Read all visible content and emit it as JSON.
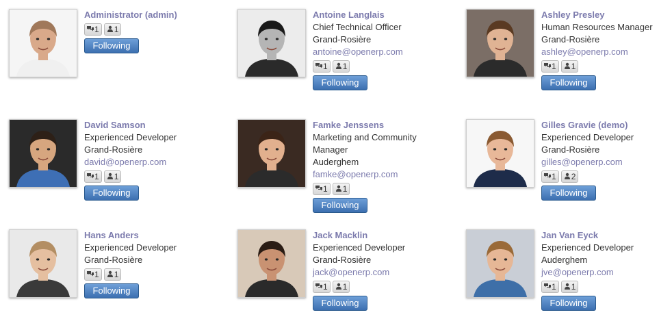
{
  "users": [
    {
      "name": "Administrator (admin)",
      "lines": [],
      "email": "",
      "messages": "1",
      "followers": "1",
      "button": "Following",
      "colors": {
        "bg": "#f5f5f5",
        "skin": "#d9a98a",
        "hair": "#a0785a",
        "shirt": "#f0f0f0"
      }
    },
    {
      "name": "Antoine Langlais",
      "lines": [
        "Chief Technical Officer",
        "Grand-Rosière"
      ],
      "email": "antoine@openerp.com",
      "messages": "1",
      "followers": "1",
      "button": "Following",
      "colors": {
        "bg": "#ececec",
        "skin": "#b5b5b5",
        "hair": "#1a1a1a",
        "shirt": "#2a2a2a"
      }
    },
    {
      "name": "Ashley Presley",
      "lines": [
        "Human Resources Manager",
        "Grand-Rosière"
      ],
      "email": "ashley@openerp.com",
      "messages": "1",
      "followers": "1",
      "button": "Following",
      "colors": {
        "bg": "#7b6e66",
        "skin": "#e0b394",
        "hair": "#5a3a22",
        "shirt": "#2b2b2b"
      }
    },
    {
      "name": "David Samson",
      "lines": [
        "Experienced Developer",
        "Grand-Rosière"
      ],
      "email": "david@openerp.com",
      "messages": "1",
      "followers": "1",
      "button": "Following",
      "colors": {
        "bg": "#2a2a2a",
        "skin": "#d6a67f",
        "hair": "#2d2017",
        "shirt": "#3e6fb5"
      }
    },
    {
      "name": "Famke Jenssens",
      "lines": [
        "Marketing and Community",
        "Manager",
        "Auderghem"
      ],
      "email": "famke@openerp.com",
      "messages": "1",
      "followers": "1",
      "button": "Following",
      "colors": {
        "bg": "#3a2a22",
        "skin": "#e2b08e",
        "hair": "#3b2417",
        "shirt": "#2b2b2b"
      }
    },
    {
      "name": "Gilles Gravie (demo)",
      "lines": [
        "Experienced Developer",
        "Grand-Rosière"
      ],
      "email": "gilles@openerp.com",
      "messages": "1",
      "followers": "2",
      "button": "Following",
      "colors": {
        "bg": "#f7f7f7",
        "skin": "#e8b899",
        "hair": "#8a5a32",
        "shirt": "#1e2c4a"
      }
    },
    {
      "name": "Hans Anders",
      "lines": [
        "Experienced Developer",
        "Grand-Rosière"
      ],
      "email": "",
      "messages": "1",
      "followers": "1",
      "button": "Following",
      "colors": {
        "bg": "#e9e9e9",
        "skin": "#e5bfa0",
        "hair": "#b38e63",
        "shirt": "#3a3a3a"
      }
    },
    {
      "name": "Jack Macklin",
      "lines": [
        "Experienced Developer",
        "Grand-Rosière"
      ],
      "email": "jack@openerp.com",
      "messages": "1",
      "followers": "1",
      "button": "Following",
      "colors": {
        "bg": "#d8c9b8",
        "skin": "#c99272",
        "hair": "#2a1c14",
        "shirt": "#2a2a2a"
      }
    },
    {
      "name": "Jan Van Eyck",
      "lines": [
        "Experienced Developer",
        "Auderghem"
      ],
      "email": "jve@openerp.com",
      "messages": "1",
      "followers": "1",
      "button": "Following",
      "colors": {
        "bg": "#c9ced6",
        "skin": "#e6b796",
        "hair": "#9a6a38",
        "shirt": "#3e6fa8"
      }
    }
  ]
}
